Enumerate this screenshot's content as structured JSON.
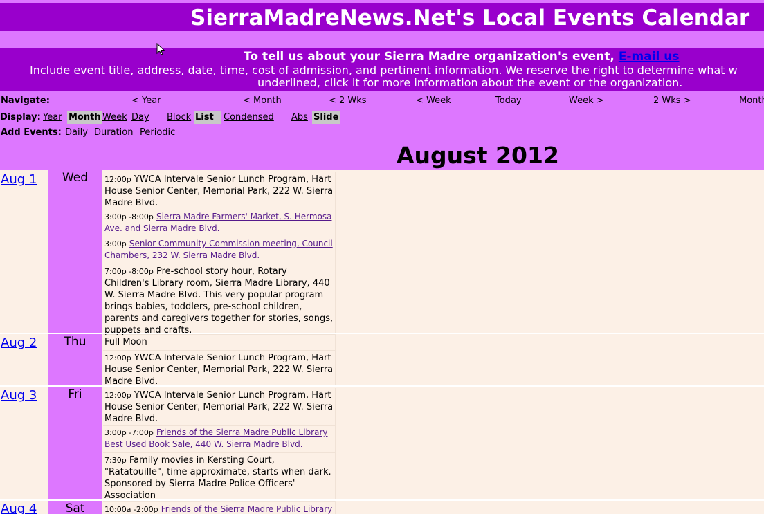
{
  "header": {
    "title": "SierraMadreNews.Net's Local Events Calendar"
  },
  "info": {
    "line1_text": "To tell us about your Sierra Madre organization's event,",
    "line1_link": "E-mail us",
    "line2": "Include event title, address, date, time, cost of admission, and pertinent information. We reserve the right to determine what w",
    "line3": "underlined, click it for more information about the event or the organization."
  },
  "navigate": {
    "label": "Navigate:",
    "items": [
      "< Year",
      "< Month",
      "< 2 Wks",
      "< Week",
      "Today",
      "Week >",
      "2 Wks >",
      "Month"
    ]
  },
  "display": {
    "label": "Display:",
    "items": [
      "Year",
      "Month",
      "Week",
      "Day",
      "Block",
      "List",
      "Condensed",
      "Abs",
      "Slide"
    ],
    "active": [
      "Month",
      "List",
      "Slide"
    ]
  },
  "add_events": {
    "label": "Add Events:",
    "items": [
      "Daily",
      "Duration",
      "Periodic"
    ]
  },
  "month_title": "August 2012",
  "days": [
    {
      "date": "Aug 1",
      "weekday": "Wed",
      "events": [
        {
          "time": "12:00p",
          "text": "YWCA Intervale Senior Lunch Program, Hart House Senior Center, Memorial Park, 222 W. Sierra Madre Blvd.",
          "link": false
        },
        {
          "time": "3:00p -8:00p",
          "text": "Sierra Madre Farmers' Market, S. Hermosa Ave. and Sierra Madre Blvd.",
          "link": true
        },
        {
          "time": "3:00p",
          "text": "Senior Community Commission meeting, Council Chambers, 232 W. Sierra Madre Blvd.",
          "link": true
        },
        {
          "time": "7:00p -8:00p",
          "text": "Pre-school story hour, Rotary Children's Library room, Sierra Madre Library, 440 W. Sierra Madre Blvd. This very popular program brings babies, toddlers, pre-school children, parents and caregivers together for stories, songs, puppets and crafts.",
          "link": false
        }
      ]
    },
    {
      "date": "Aug 2",
      "weekday": "Thu",
      "events": [
        {
          "time": "",
          "text": "Full Moon",
          "link": false
        },
        {
          "time": "12:00p",
          "text": "YWCA Intervale Senior Lunch Program, Hart House Senior Center, Memorial Park, 222 W. Sierra Madre Blvd.",
          "link": false
        }
      ]
    },
    {
      "date": "Aug 3",
      "weekday": "Fri",
      "events": [
        {
          "time": "12:00p",
          "text": "YWCA Intervale Senior Lunch Program, Hart House Senior Center, Memorial Park, 222 W. Sierra Madre Blvd.",
          "link": false
        },
        {
          "time": "3:00p -7:00p",
          "text": "Friends of the Sierra Madre Public Library Best Used Book Sale, 440 W. Sierra Madre Blvd.",
          "link": true
        },
        {
          "time": "7:30p",
          "text": "Family movies in Kersting Court, \"Ratatouille\", time approximate, starts when dark. Sponsored by Sierra Madre Police Officers' Association",
          "link": false
        }
      ]
    },
    {
      "date": "Aug 4",
      "weekday": "Sat",
      "events": [
        {
          "time": "10:00a -2:00p",
          "text": "Friends of the Sierra Madre Public Library",
          "link": true
        }
      ]
    }
  ]
}
